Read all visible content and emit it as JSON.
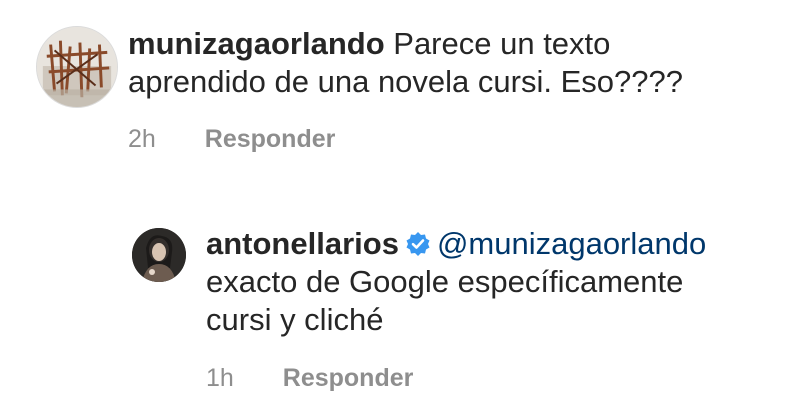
{
  "comments": [
    {
      "username": "munizagaorlando",
      "text_line1": "Parece un texto",
      "text_line2": "aprendido de una novela cursi.  Eso????",
      "time": "2h",
      "reply_label": "Responder",
      "verified": false
    },
    {
      "username": "antonellarios",
      "mention": "@munizagaorlando",
      "text_line2": "exacto de Google específicamente",
      "text_line3": "cursi y cliché",
      "time": "1h",
      "reply_label": "Responder",
      "verified": true
    }
  ],
  "colors": {
    "text": "#262626",
    "meta": "#8e8e8e",
    "mention": "#00376b",
    "verified_badge": "#3897f0"
  },
  "icons": {
    "verified": "verified-badge-icon"
  }
}
